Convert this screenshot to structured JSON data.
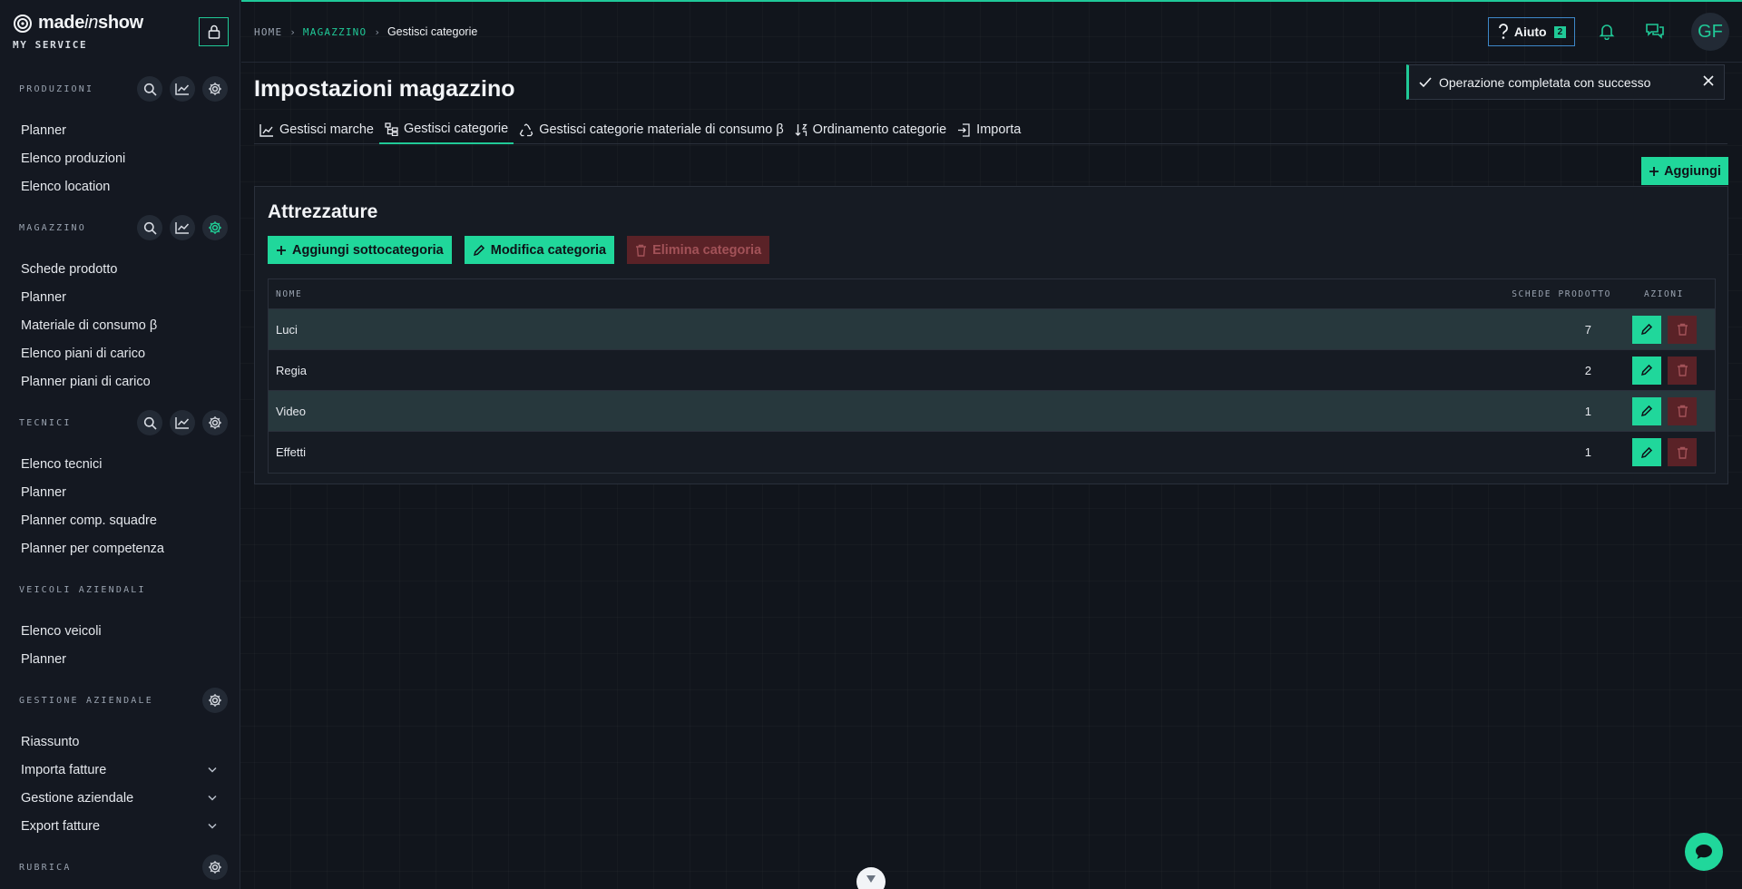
{
  "brand": {
    "name_a": "made",
    "name_b": "in",
    "name_c": "show",
    "subtitle": "MY SERVICE"
  },
  "sidebar": {
    "sections": [
      {
        "title": "PRODUZIONI",
        "tools": [
          "search-icon",
          "chart-icon",
          "gear-icon"
        ],
        "items": [
          "Planner",
          "Elenco produzioni",
          "Elenco location"
        ]
      },
      {
        "title": "MAGAZZINO",
        "tools": [
          "search-icon",
          "chart-icon",
          "gear-icon"
        ],
        "active_tool": "gear-icon",
        "items": [
          "Schede prodotto",
          "Planner",
          "Materiale di consumo β",
          "Elenco piani di carico",
          "Planner piani di carico"
        ]
      },
      {
        "title": "TECNICI",
        "tools": [
          "search-icon",
          "chart-icon",
          "gear-icon"
        ],
        "items": [
          "Elenco tecnici",
          "Planner",
          "Planner comp. squadre",
          "Planner per competenza"
        ]
      },
      {
        "title": "VEICOLI AZIENDALI",
        "tools": [],
        "items": [
          "Elenco veicoli",
          "Planner"
        ]
      },
      {
        "title": "GESTIONE AZIENDALE",
        "tools": [
          "gear-icon"
        ],
        "items": [
          "Riassunto",
          "Importa fatture",
          "Gestione aziendale",
          "Export fatture"
        ],
        "expandable": [
          "Importa fatture",
          "Gestione aziendale",
          "Export fatture"
        ]
      },
      {
        "title": "RUBRICA",
        "tools": [
          "gear-icon"
        ],
        "items": []
      }
    ]
  },
  "breadcrumb": {
    "home": "HOME",
    "section": "MAGAZZINO",
    "current": "Gestisci categorie"
  },
  "header": {
    "help_label": "Aiuto",
    "help_count": "2",
    "avatar_initials": "GF"
  },
  "page": {
    "title": "Impostazioni magazzino",
    "tabs": [
      {
        "label": "Gestisci marche",
        "icon": "chart-bar-icon",
        "active": false
      },
      {
        "label": "Gestisci categorie",
        "icon": "tree-icon",
        "active": true
      },
      {
        "label": "Gestisci categorie materiale di consumo β",
        "icon": "recycle-icon",
        "active": false
      },
      {
        "label": "Ordinamento categorie",
        "icon": "sort-icon",
        "active": false
      },
      {
        "label": "Importa",
        "icon": "import-icon",
        "active": false
      }
    ],
    "add_label": "Aggiungi"
  },
  "category": {
    "title": "Attrezzature",
    "actions": {
      "add_sub": "Aggiungi sottocategoria",
      "edit": "Modifica categoria",
      "delete": "Elimina categoria"
    },
    "table": {
      "headers": {
        "name": "NOME",
        "count": "SCHEDE PRODOTTO",
        "actions": "AZIONI"
      },
      "rows": [
        {
          "name": "Luci",
          "count": "7"
        },
        {
          "name": "Regia",
          "count": "2"
        },
        {
          "name": "Video",
          "count": "1"
        },
        {
          "name": "Effetti",
          "count": "1"
        }
      ]
    }
  },
  "toast": {
    "message": "Operazione completata con successo"
  },
  "colors": {
    "accent": "#20d79b",
    "danger": "#5a2227",
    "background": "#11151c"
  }
}
